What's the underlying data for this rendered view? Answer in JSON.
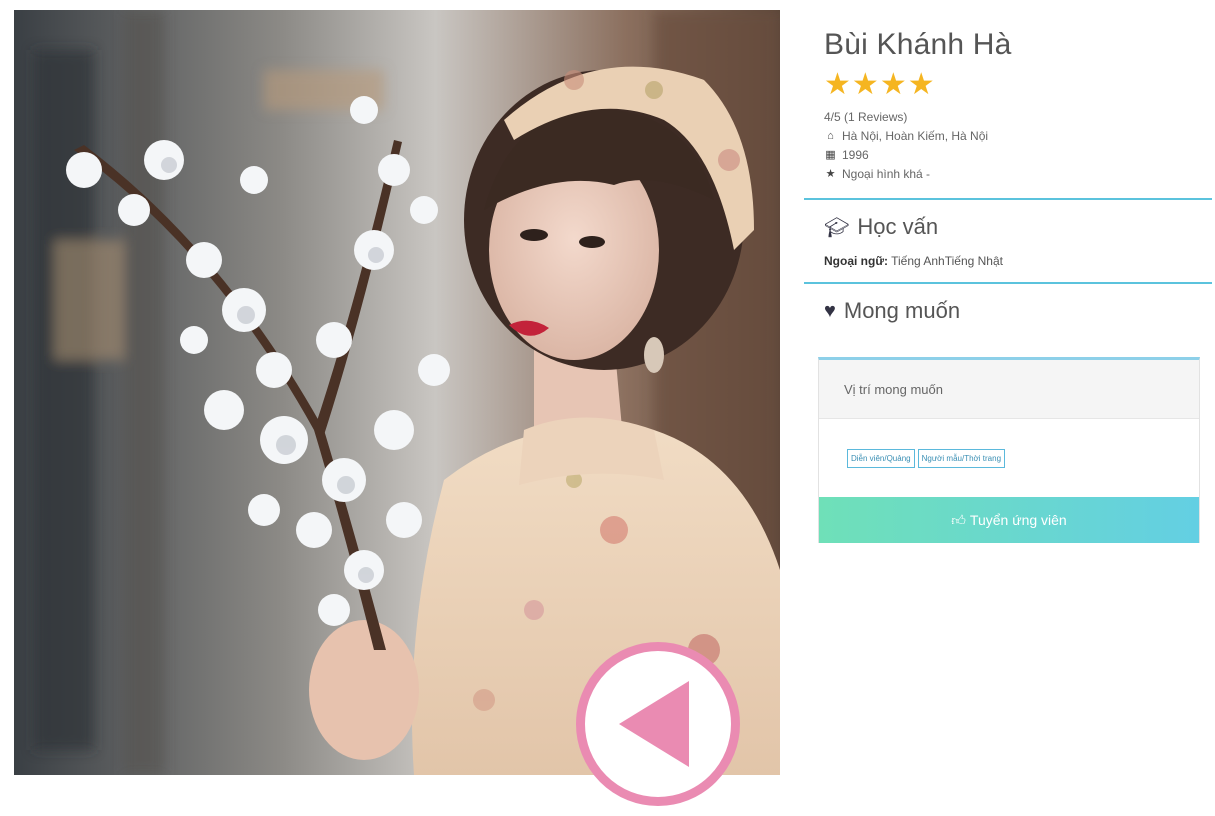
{
  "profile": {
    "name": "Bùi Khánh Hà",
    "stars": 4,
    "rating_text": "4/5 (1 Reviews)",
    "location": "Hà Nội, Hoàn Kiếm, Hà Nội",
    "birth_year": "1996",
    "appearance": "Ngoại hình khá -"
  },
  "education": {
    "title": "Học vấn",
    "language_label": "Ngoại ngữ:",
    "language_value": " Tiếng AnhTiếng Nhật"
  },
  "wishes": {
    "title": "Mong muốn",
    "position_header": "Vị trí mong muốn",
    "tags": [
      "Diễn viên/Quảng",
      "Người mẫu/Thời trang"
    ],
    "hire_button": "Tuyển ứng viên"
  },
  "icons": {
    "location": "home-icon",
    "birth": "calendar-icon",
    "appearance": "star-icon",
    "education": "graduation-cap-icon",
    "wishes": "heart-icon",
    "hire": "thumbs-up-icon",
    "nav": "play-left-icon"
  },
  "colors": {
    "star": "#f5b521",
    "accent_line": "#5bc3dd",
    "button_gradient_start": "#6fe0b8",
    "button_gradient_end": "#63cfe3",
    "nav_pink": "#ea8bb2"
  }
}
